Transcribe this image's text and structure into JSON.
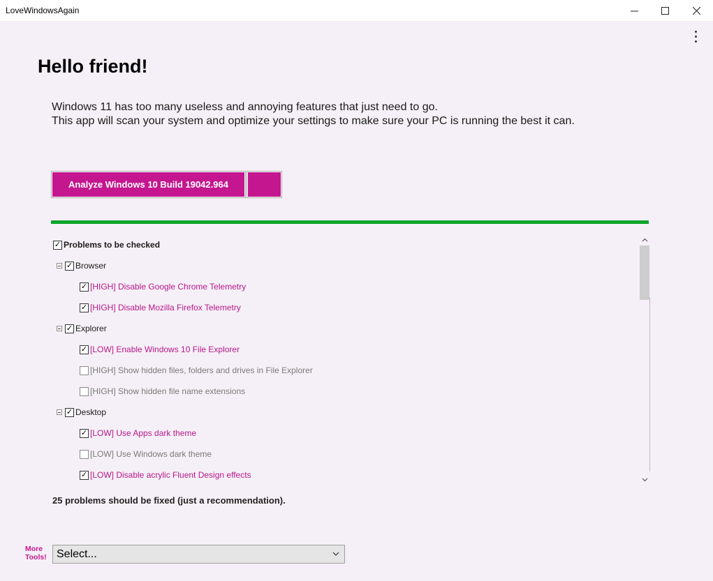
{
  "window": {
    "title": "LoveWindowsAgain",
    "minimize_glyph": "—",
    "maximize_glyph": "☐",
    "close_glyph": "✕"
  },
  "header": {
    "greeting": "Hello friend!",
    "intro_line1": "Windows 11 has too many useless and annoying features that just need to go.",
    "intro_line2": "This app will scan your system and optimize your settings to make sure your PC is running the best it can."
  },
  "actions": {
    "analyze_label": "Analyze Windows 10 Build 19042.964",
    "accent_color": "#c4168f"
  },
  "progress": {
    "fraction": 1.0,
    "color": "#0aa52b"
  },
  "tree": {
    "root": {
      "label": "Problems to be checked",
      "checked": true
    },
    "groups": [
      {
        "label": "Browser",
        "checked": true,
        "items": [
          {
            "label": "[HIGH] Disable Google Chrome Telemetry",
            "checked": true
          },
          {
            "label": "[HIGH] Disable Mozilla Firefox Telemetry",
            "checked": true
          }
        ]
      },
      {
        "label": "Explorer",
        "checked": true,
        "items": [
          {
            "label": "[LOW] Enable Windows 10 File Explorer",
            "checked": true
          },
          {
            "label": "[HIGH] Show hidden files, folders and drives in File Explorer",
            "checked": false
          },
          {
            "label": "[HIGH] Show hidden file name extensions",
            "checked": false
          }
        ]
      },
      {
        "label": "Desktop",
        "checked": true,
        "items": [
          {
            "label": "[LOW] Use Apps dark theme",
            "checked": true
          },
          {
            "label": "[LOW] Use Windows dark theme",
            "checked": false
          },
          {
            "label": "[LOW] Disable acrylic Fluent Design effects",
            "checked": true
          }
        ]
      }
    ]
  },
  "summary": "25 problems should be fixed (just a recommendation).",
  "more_tools": {
    "label_line1": "More",
    "label_line2": "Tools!",
    "selected": "Select..."
  },
  "icons": {
    "menu": "kebab-menu-icon",
    "scroll_up": "chevron-up-icon",
    "scroll_down": "chevron-down-icon",
    "dropdown": "chevron-down-icon"
  }
}
